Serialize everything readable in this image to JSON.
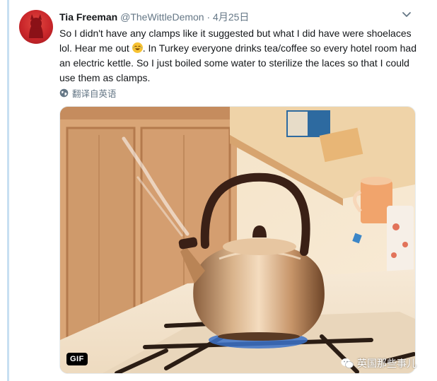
{
  "tweet": {
    "author_name": "Tia Freeman",
    "handle": "@TheWittleDemon",
    "separator": "·",
    "date": "4月25日",
    "text_before_emoji": "So I didn't have any clamps like it suggested but what I did have were shoelaces lol. Hear me out ",
    "emoji_icon": "face-with-tears-of-joy",
    "text_after_emoji": ". In Turkey everyone drinks tea/coffee so every hotel room had an electric kettle. So I just boiled some water to sterilize the laces so that I could use them as clamps.",
    "translate_label": "翻译自英语"
  },
  "media": {
    "badge": "GIF",
    "watermark": "英国那些事儿"
  },
  "colors": {
    "thread_line": "#c7dff2",
    "secondary_text": "#657786",
    "avatar": "#c9262a"
  }
}
